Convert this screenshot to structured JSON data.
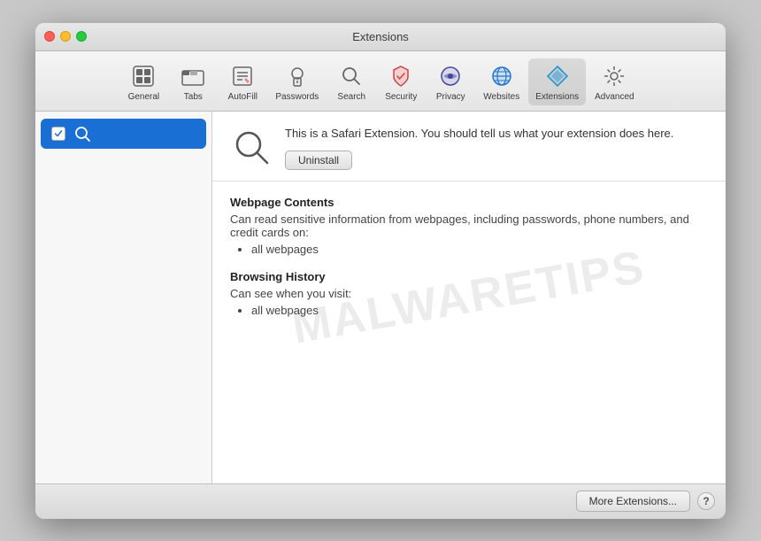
{
  "window": {
    "title": "Extensions"
  },
  "toolbar": {
    "items": [
      {
        "id": "general",
        "label": "General",
        "icon": "general-icon"
      },
      {
        "id": "tabs",
        "label": "Tabs",
        "icon": "tabs-icon"
      },
      {
        "id": "autofill",
        "label": "AutoFill",
        "icon": "autofill-icon"
      },
      {
        "id": "passwords",
        "label": "Passwords",
        "icon": "passwords-icon"
      },
      {
        "id": "search",
        "label": "Search",
        "icon": "search-icon"
      },
      {
        "id": "security",
        "label": "Security",
        "icon": "security-icon"
      },
      {
        "id": "privacy",
        "label": "Privacy",
        "icon": "privacy-icon"
      },
      {
        "id": "websites",
        "label": "Websites",
        "icon": "websites-icon"
      },
      {
        "id": "extensions",
        "label": "Extensions",
        "icon": "extensions-icon",
        "active": true
      },
      {
        "id": "advanced",
        "label": "Advanced",
        "icon": "advanced-icon"
      }
    ]
  },
  "sidebar": {
    "items": [
      {
        "id": "search-ext",
        "label": "",
        "checked": true,
        "icon": "search-ext-icon"
      }
    ]
  },
  "extension": {
    "description": "This is a Safari Extension. You should tell us what your extension does here.",
    "uninstall_label": "Uninstall"
  },
  "permissions": {
    "sections": [
      {
        "title": "Webpage Contents",
        "description": "Can read sensitive information from webpages, including passwords, phone numbers, and credit cards on:",
        "items": [
          "all webpages"
        ]
      },
      {
        "title": "Browsing History",
        "description": "Can see when you visit:",
        "items": [
          "all webpages"
        ]
      }
    ]
  },
  "footer": {
    "more_extensions_label": "More Extensions...",
    "help_label": "?"
  },
  "watermark": {
    "text": "MALWARETIPS"
  }
}
